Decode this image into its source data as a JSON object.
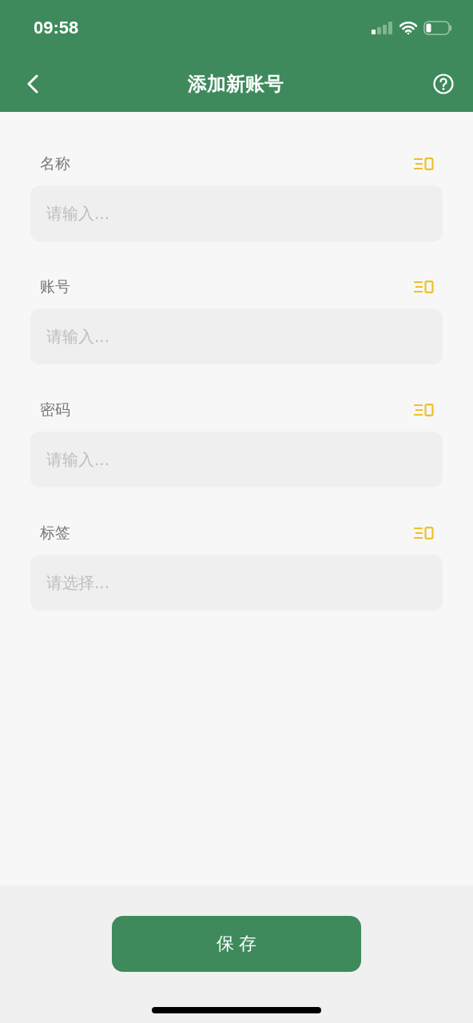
{
  "status_bar": {
    "time": "09:58"
  },
  "nav": {
    "title": "添加新账号"
  },
  "fields": [
    {
      "label": "名称",
      "placeholder": "请输入..."
    },
    {
      "label": "账号",
      "placeholder": "请输入..."
    },
    {
      "label": "密码",
      "placeholder": "请输入..."
    },
    {
      "label": "标签",
      "placeholder": "请选择..."
    }
  ],
  "save_button": "保 存"
}
